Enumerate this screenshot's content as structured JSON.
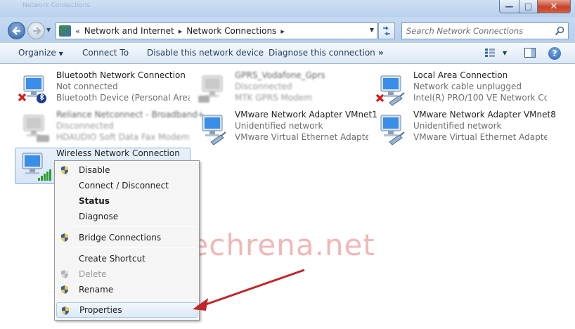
{
  "window": {
    "title": "Network Connections",
    "close_label": "✕",
    "min_label": "—",
    "max_label": "□"
  },
  "address": {
    "crumbs": [
      "Network and Internet",
      "Network Connections"
    ],
    "prefix": "«"
  },
  "search": {
    "placeholder": "Search Network Connections"
  },
  "toolbar": {
    "organize": "Organize",
    "connect": "Connect To",
    "disable": "Disable this network device",
    "diagnose": "Diagnose this connection",
    "more": "»",
    "help": "?"
  },
  "connections": [
    {
      "name": "Bluetooth Network Connection",
      "status": "Not connected",
      "device": "Bluetooth Device (Personal Area ..."
    },
    {
      "name": "GPRS_Vodafone_Gprs",
      "status": "Disconnected",
      "device": "MTK GPRS Modem"
    },
    {
      "name": "Local Area Connection",
      "status": "Network cable unplugged",
      "device": "Intel(R) PRO/100 VE Network Con..."
    },
    {
      "name": "Reliance Netconnect - Broadband+",
      "status": "Disconnected",
      "device": "HDAUDIO Soft Data Fax Modem ..."
    },
    {
      "name": "VMware Network Adapter VMnet1",
      "status": "Unidentified network",
      "device": "VMware Virtual Ethernet Adapter ..."
    },
    {
      "name": "VMware Network Adapter VMnet8",
      "status": "Unidentified network",
      "device": "VMware Virtual Ethernet Adapter ..."
    },
    {
      "name": "Wireless Network Connection",
      "status": "",
      "device": ""
    }
  ],
  "context_menu": [
    {
      "label": "Disable"
    },
    {
      "label": "Connect / Disconnect"
    },
    {
      "label": "Status"
    },
    {
      "label": "Diagnose"
    },
    {
      "label": "Bridge Connections"
    },
    {
      "label": "Create Shortcut"
    },
    {
      "label": "Delete"
    },
    {
      "label": "Rename"
    },
    {
      "label": "Properties"
    }
  ],
  "watermark": "techrena.net",
  "colors": {
    "accent": "#1f5ea8",
    "arrow": "#c0262a",
    "watermark": "#f0b7b7"
  }
}
